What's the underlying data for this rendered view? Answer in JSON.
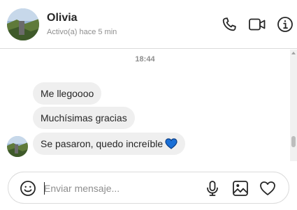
{
  "header": {
    "name": "Olivia",
    "status": "Activo(a) hace 5 min",
    "icons": [
      "phone-icon",
      "video-icon",
      "info-icon"
    ]
  },
  "thread": {
    "timestamp": "18:44",
    "messages": [
      {
        "text": "Me llegoooo"
      },
      {
        "text": "Muchísimas gracias"
      },
      {
        "text": "Se pasaron, quedo increíble",
        "emoji": "blue-heart"
      }
    ]
  },
  "composer": {
    "placeholder": "Enviar mensaje...",
    "icons": [
      "emoji-icon",
      "microphone-icon",
      "image-icon",
      "heart-icon"
    ]
  },
  "colors": {
    "bubble_bg": "#efefef",
    "muted_text": "#8e8e8e",
    "border": "#dbdbdb",
    "heart_blue": "#0095f6"
  }
}
